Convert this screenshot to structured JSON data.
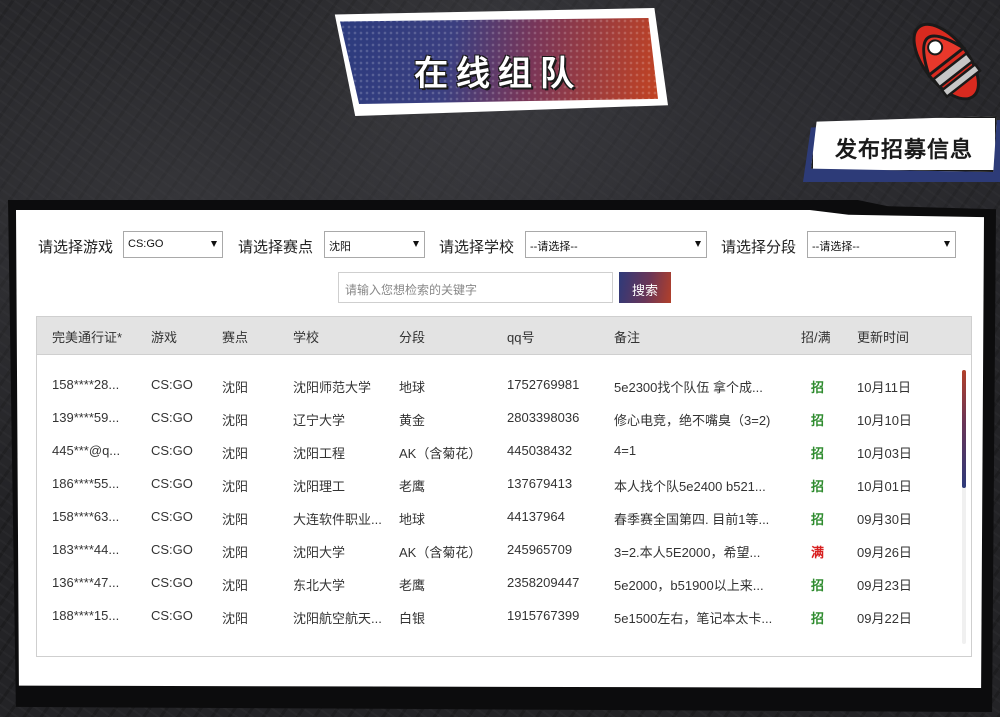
{
  "header": {
    "title": "在线组队",
    "publish_label": "发布招募信息"
  },
  "filters": {
    "game_label": "请选择游戏",
    "game_value": "CS:GO",
    "venue_label": "请选择赛点",
    "venue_value": "沈阳",
    "school_label": "请选择学校",
    "school_value": "--请选择--",
    "rank_label": "请选择分段",
    "rank_value": "--请选择--"
  },
  "search": {
    "placeholder": "请输入您想检索的关键字",
    "button_label": "搜索"
  },
  "table": {
    "columns": [
      "完美通行证*",
      "游戏",
      "赛点",
      "学校",
      "分段",
      "qq号",
      "备注",
      "招/满",
      "更新时间"
    ],
    "rows": [
      {
        "pass": "158****28...",
        "game": "CS:GO",
        "venue": "沈阳",
        "school": "沈阳师范大学",
        "rank": "地球",
        "qq": "1752769981",
        "note": "5e2300找个队伍 拿个成...",
        "status": "招",
        "updated": "10月11日"
      },
      {
        "pass": "139****59...",
        "game": "CS:GO",
        "venue": "沈阳",
        "school": "辽宁大学",
        "rank": "黄金",
        "qq": "2803398036",
        "note": "修心电竞，绝不嘴臭（3=2)",
        "status": "招",
        "updated": "10月10日"
      },
      {
        "pass": "445***@q...",
        "game": "CS:GO",
        "venue": "沈阳",
        "school": "沈阳工程",
        "rank": "AK（含菊花）",
        "qq": "445038432",
        "note": "4=1",
        "status": "招",
        "updated": "10月03日"
      },
      {
        "pass": "186****55...",
        "game": "CS:GO",
        "venue": "沈阳",
        "school": "沈阳理工",
        "rank": "老鹰",
        "qq": "137679413",
        "note": "本人找个队5e2400 b521...",
        "status": "招",
        "updated": "10月01日"
      },
      {
        "pass": "158****63...",
        "game": "CS:GO",
        "venue": "沈阳",
        "school": "大连软件职业...",
        "rank": "地球",
        "qq": "44137964",
        "note": "春季赛全国第四. 目前1等...",
        "status": "招",
        "updated": "09月30日"
      },
      {
        "pass": "183****44...",
        "game": "CS:GO",
        "venue": "沈阳",
        "school": "沈阳大学",
        "rank": "AK（含菊花）",
        "qq": "245965709",
        "note": "3=2.本人5E2000，希望...",
        "status": "满",
        "updated": "09月26日"
      },
      {
        "pass": "136****47...",
        "game": "CS:GO",
        "venue": "沈阳",
        "school": "东北大学",
        "rank": "老鹰",
        "qq": "2358209447",
        "note": "5e2000，b51900以上来...",
        "status": "招",
        "updated": "09月23日"
      },
      {
        "pass": "188****15...",
        "game": "CS:GO",
        "venue": "沈阳",
        "school": "沈阳航空航天...",
        "rank": "白银",
        "qq": "1915767399",
        "note": "5e1500左右，笔记本太卡...",
        "status": "招",
        "updated": "09月22日"
      }
    ]
  },
  "colors": {
    "recruit": "#2e8b2e",
    "full": "#d82020",
    "accent_blue": "#2e3a7a",
    "accent_red": "#b2402a"
  },
  "icons": {
    "rocket": "rocket-icon",
    "dropdown": "chevron-down-icon"
  }
}
